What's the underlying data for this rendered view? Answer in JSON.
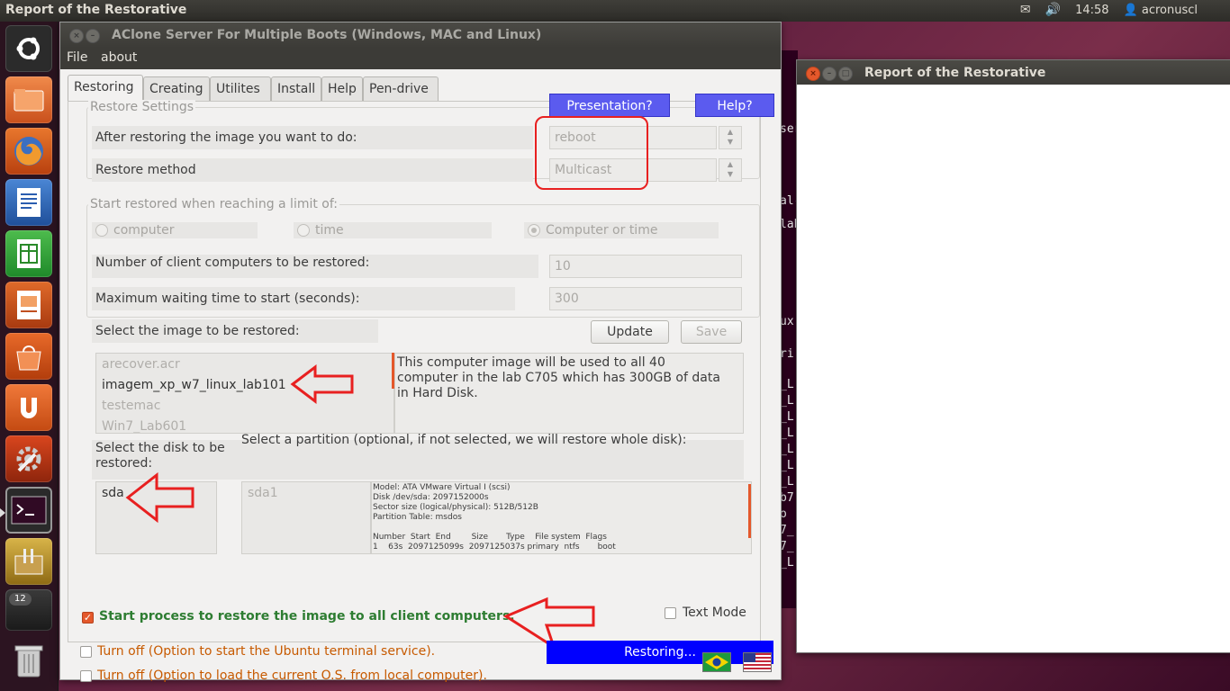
{
  "top_panel": {
    "title": "Report of the Restorative",
    "time": "14:58",
    "user": "acronuscl"
  },
  "launcher": {
    "badge_count": "12"
  },
  "main_window": {
    "title": "AClone Server For Multiple Boots (Windows, MAC and Linux)",
    "menu": {
      "file": "File",
      "about": "about"
    },
    "tabs": [
      "Restoring",
      "Creating",
      "Utilites",
      "Install",
      "Help",
      "Pen-drive"
    ],
    "presentation_button": "Presentation?",
    "help_button": "Help?",
    "restore_settings": {
      "group_label": "Restore Settings",
      "after_restore_label": "After restoring the image you want to do:",
      "after_restore_value": "reboot",
      "method_label": "Restore method",
      "method_value": "Multicast"
    },
    "limit_group": {
      "label": "Start restored when reaching a limit of:",
      "options": [
        "computer",
        "time",
        "Computer or time"
      ],
      "selected": "Computer or time",
      "clients_label": "Number of client computers to be restored:",
      "clients_value": "10",
      "wait_label": "Maximum waiting time to start (seconds):",
      "wait_value": "300"
    },
    "image_select": {
      "label": "Select the image to be restored:",
      "update_button": "Update",
      "save_button": "Save",
      "images": [
        "arecover.acr",
        "imagem_xp_w7_linux_lab101",
        "testemac",
        "Win7_Lab601"
      ],
      "selected": "imagem_xp_w7_linux_lab101",
      "description": "This computer image will be used to all 40 computer in the lab C705 which has 300GB of data in Hard Disk."
    },
    "disk_select": {
      "label": "Select the disk to be restored:",
      "partition_label": "Select a partition (optional, if not selected, we will restore whole disk):",
      "disks": [
        "sda"
      ],
      "partitions": [
        "sda1"
      ],
      "disk_info": [
        "Model: ATA VMware Virtual I (scsi)",
        "Disk /dev/sda: 2097152000s",
        "Sector size (logical/physical): 512B/512B",
        "Partition Table: msdos",
        "",
        "Number  Start  End        Size       Type    File system  Flags",
        "1    63s  2097125099s  2097125037s primary  ntfs       boot"
      ]
    },
    "start_process": {
      "label": "Start process to restore the image to all client computers.",
      "checked": true
    },
    "text_mode": {
      "label": "Text Mode",
      "checked": false
    },
    "turn_off_terminal": "Turn off (Option to start the Ubuntu terminal service).",
    "turn_off_local": "Turn off (Option to load the current O.S. from local computer).",
    "restoring_button": "Restoring..."
  },
  "report_window": {
    "title": "Report of the Restorative"
  },
  "terminal_fragments": [
    "ser",
    "al-r",
    "lab",
    "ux",
    "ri",
    "_L",
    "_L",
    "_L",
    "_L",
    "_L",
    "_L",
    "_L",
    "b7",
    "o",
    "7_",
    "7_",
    "_L"
  ],
  "colors": {
    "accent_blue": "#5b5bef",
    "restoring_blue": "#0000ff",
    "start_text_green": "#2e7d32",
    "turnoff_text_orange": "#c75a00",
    "annotation_red": "#e82020"
  }
}
